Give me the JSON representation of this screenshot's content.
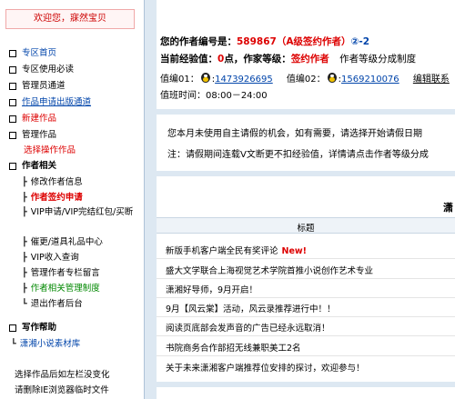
{
  "sidebar": {
    "greeting": "欢迎您，寐然宝贝",
    "items": [
      {
        "label": "专区首页"
      },
      {
        "label": "专区使用必读"
      },
      {
        "label": "管理员通道"
      },
      {
        "label": "作品申请出版通道"
      },
      {
        "label": "新建作品"
      },
      {
        "label": "管理作品"
      },
      {
        "label": "选择操作作品"
      }
    ],
    "author_section": {
      "title": "作者相关",
      "links": [
        {
          "label": "修改作者信息"
        },
        {
          "label": "作者签约申请"
        },
        {
          "label": "VIP申请/VIP完结红包/买断"
        },
        {
          "label": "催更/道具礼品中心"
        },
        {
          "label": "VIP收入查询"
        },
        {
          "label": "管理作者专栏留言"
        },
        {
          "label": "作者相关管理制度"
        },
        {
          "label": "退出作者后台"
        }
      ]
    },
    "help_section": {
      "title": "写作帮助",
      "links": [
        {
          "label": "潇湘小说素材库"
        }
      ]
    },
    "footer_tip_line1": "选择作品后如左栏没变化",
    "footer_tip_line2": "请删除IE浏览器临时文件"
  },
  "author_info": {
    "number_label": "您的作者编号是：",
    "number_value": "589867",
    "level_badge": "（A级签约作者）",
    "level_extra": "②-2",
    "exp_label": "当前经验值：",
    "exp_value": "0",
    "exp_unit": "点，",
    "grade_label": "作家等级：",
    "grade_value": "签约作者",
    "grade_note": "作者等级分成制度",
    "duty1_label": "值编01：",
    "duty1_qq": "1473926695",
    "duty2_label": "值编02：",
    "duty2_qq": "1569210076",
    "edit_contact": "编辑联系",
    "hours_label": "值班时间：",
    "hours_value": "08:00－24:00"
  },
  "notice": {
    "line1": "您本月未使用自主请假的机会，如有需要，请选择开始请假日期",
    "line2": "注：请假期间连载V文断更不扣经验值，详情请点击作者等级分成"
  },
  "news": {
    "section_title": "潇",
    "column_header": "标题",
    "new_badge": "New!",
    "items": [
      {
        "title": "新版手机客户端全民有奖评论",
        "is_new": true
      },
      {
        "title": "盛大文学联合上海视觉艺术学院首推小说创作艺术专业"
      },
      {
        "title": "潇湘好导师，9月开启！"
      },
      {
        "title": "9月【风云棠】活动，风云录推荐进行中！！"
      },
      {
        "title": "阅读页底部会发声音的广告已经永远取消！"
      },
      {
        "title": "书院商务合作部招无线兼职美工2名"
      },
      {
        "title": "关于未来潇湘客户端推荐位安排的探讨，欢迎参与！"
      }
    ]
  },
  "colors": {
    "accent_red": "#dd0000",
    "link_blue": "#0044aa",
    "bg": "#dde8f2"
  }
}
